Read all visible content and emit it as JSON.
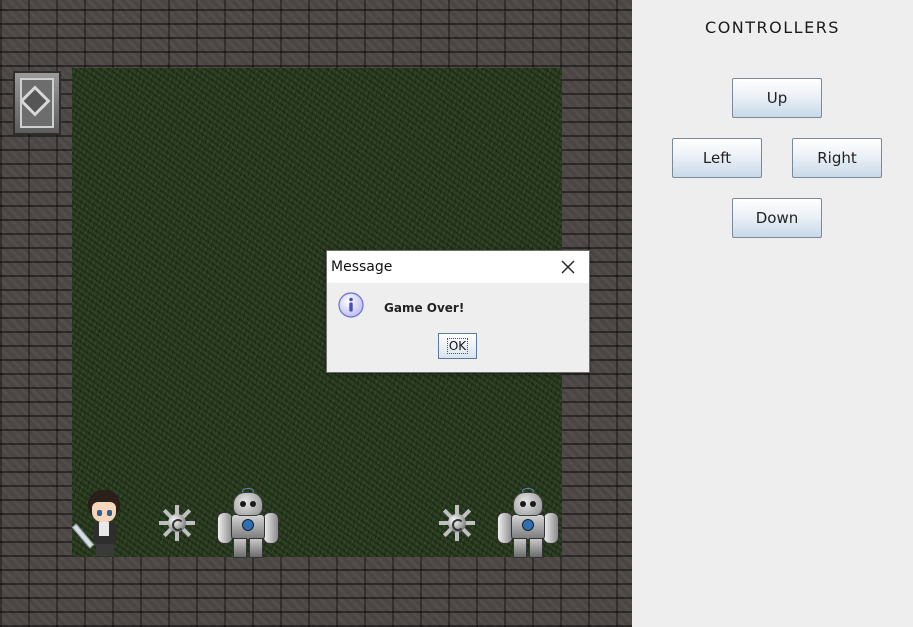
{
  "controllers": {
    "title": "CONTROLLERS",
    "up_label": "Up",
    "left_label": "Left",
    "right_label": "Right",
    "down_label": "Down"
  },
  "dialog": {
    "title": "Message",
    "message": "Game Over!",
    "ok_label": "OK",
    "icon": "info-icon",
    "close_icon": "close-icon"
  },
  "board": {
    "floor": "grass",
    "wall": "stone-brick",
    "entities": [
      "exit-door",
      "hero",
      "spike-ball",
      "robot",
      "spike-ball",
      "robot"
    ]
  },
  "colors": {
    "panel_bg": "#eeeeee",
    "button_gradient_end": "#c9d9e8",
    "info_icon": "#6d6fd0"
  }
}
